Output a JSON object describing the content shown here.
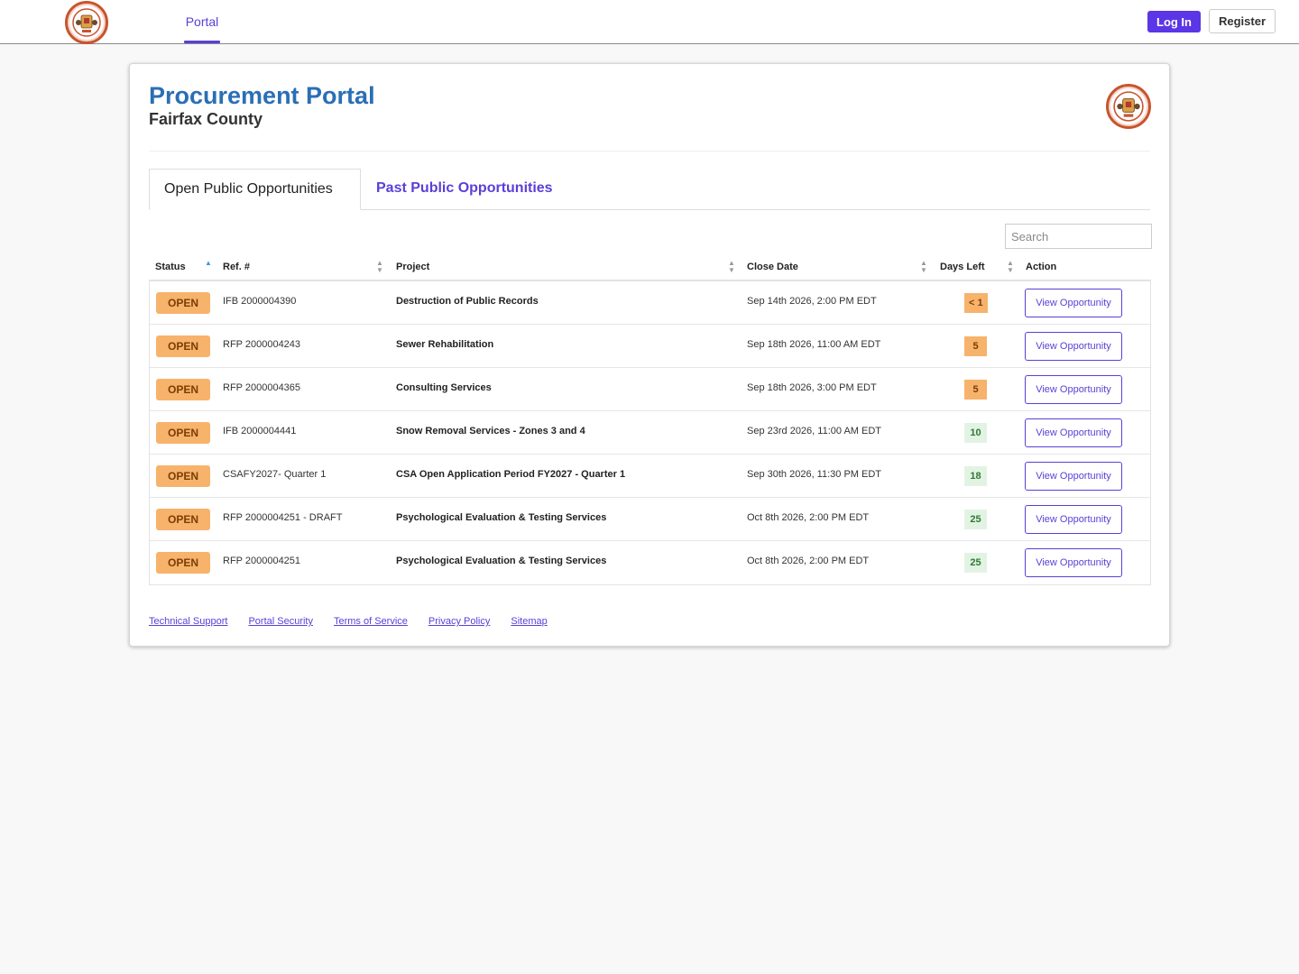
{
  "nav": {
    "portal_tab": "Portal",
    "login_label": "Log In",
    "register_label": "Register"
  },
  "header": {
    "title": "Procurement Portal",
    "subtitle": "Fairfax County"
  },
  "tabs": {
    "open": "Open Public Opportunities",
    "past": "Past Public Opportunities"
  },
  "search": {
    "placeholder": "Search"
  },
  "table": {
    "headers": {
      "status": "Status",
      "ref": "Ref. #",
      "project": "Project",
      "close_date": "Close Date",
      "days_left": "Days Left",
      "action": "Action"
    },
    "rows": [
      {
        "status": "OPEN",
        "ref": "IFB 2000004390",
        "project": "Destruction of Public Records",
        "close_date": "Sep 14th 2026, 2:00 PM EDT",
        "days_left": "< 1",
        "action": "View Opportunity"
      },
      {
        "status": "OPEN",
        "ref": "RFP 2000004243",
        "project": "Sewer Rehabilitation",
        "close_date": "Sep 18th 2026, 11:00 AM EDT",
        "days_left": "5",
        "action": "View Opportunity"
      },
      {
        "status": "OPEN",
        "ref": "RFP 2000004365",
        "project": "Consulting Services",
        "close_date": "Sep 18th 2026, 3:00 PM EDT",
        "days_left": "5",
        "action": "View Opportunity"
      },
      {
        "status": "OPEN",
        "ref": "IFB 2000004441",
        "project": "Snow Removal Services - Zones 3 and 4",
        "close_date": "Sep 23rd 2026, 11:00 AM EDT",
        "days_left": "10",
        "action": "View Opportunity"
      },
      {
        "status": "OPEN",
        "ref": "CSAFY2027- Quarter 1",
        "project": "CSA Open Application Period FY2027 - Quarter 1",
        "close_date": "Sep 30th 2026, 11:30 PM EDT",
        "days_left": "18",
        "action": "View Opportunity"
      },
      {
        "status": "OPEN",
        "ref": "RFP 2000004251 - DRAFT",
        "project": "Psychological Evaluation & Testing Services",
        "close_date": "Oct 8th 2026, 2:00 PM EDT",
        "days_left": "25",
        "action": "View Opportunity"
      },
      {
        "status": "OPEN",
        "ref": "RFP 2000004251",
        "project": "Psychological Evaluation & Testing Services",
        "close_date": "Oct 8th 2026, 2:00 PM EDT",
        "days_left": "25",
        "action": "View Opportunity"
      }
    ]
  },
  "footer": {
    "links": [
      "Technical Support",
      "Portal Security",
      "Terms of Service",
      "Privacy Policy",
      "Sitemap"
    ]
  },
  "colors": {
    "accent": "#5b3fd6",
    "title_blue": "#2a6fb5",
    "status_orange": "#f7b36b",
    "days_green_bg": "#e2f3e3",
    "seal_red": "#c8542e"
  },
  "icons": {
    "logo": "county-seal-icon",
    "sort_both": "sort-both-icon",
    "sort_asc": "sort-asc-icon"
  }
}
